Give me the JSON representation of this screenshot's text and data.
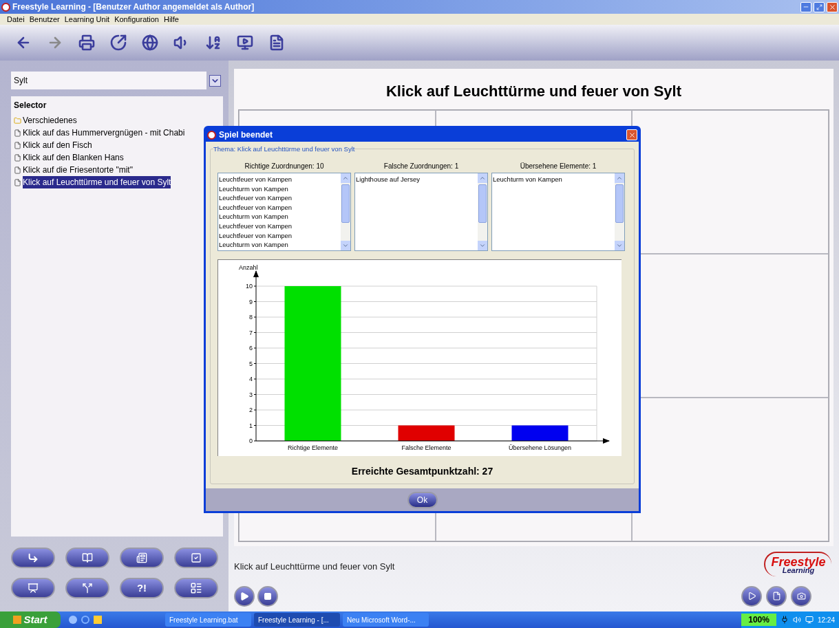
{
  "window": {
    "title": "Freestyle Learning - [Benutzer Author angemeldet als Author]"
  },
  "menu": [
    "Datei",
    "Benutzer",
    "Learning Unit",
    "Konfiguration",
    "Hilfe"
  ],
  "toolbar": [
    {
      "disabled": false
    },
    {
      "disabled": true
    },
    {
      "disabled": false
    },
    {
      "disabled": false
    },
    {
      "disabled": false
    },
    {
      "disabled": false
    },
    {
      "disabled": false
    },
    {
      "disabled": false
    },
    {
      "disabled": false
    }
  ],
  "unit_select": {
    "value": "Sylt"
  },
  "selector": {
    "title": "Selector",
    "items": [
      {
        "kind": "folder",
        "label": "Verschiedenes",
        "selected": false
      },
      {
        "kind": "document",
        "label": "Klick auf das Hummervergnügen - mit Chabi",
        "selected": false
      },
      {
        "kind": "document",
        "label": "Klick auf den Fisch",
        "selected": false
      },
      {
        "kind": "document",
        "label": "Klick auf den Blanken Hans",
        "selected": false
      },
      {
        "kind": "document",
        "label": "Klick auf die Friesentorte \"mit\"",
        "selected": false
      },
      {
        "kind": "document",
        "label": "Klick auf Leuchttürme und feuer von Sylt",
        "selected": true
      }
    ]
  },
  "quiz_button": {
    "label": "?!"
  },
  "content": {
    "title": "Klick auf Leuchttürme und feuer von Sylt",
    "caption": "Klick auf Leuchttürme und feuer von Sylt"
  },
  "logo": {
    "line1": "Freestyle",
    "line2": "Learning"
  },
  "dialog": {
    "title": "Spiel beendet",
    "group_title": "Thema: Klick auf Leuchttürme und feuer von Sylt",
    "lists": [
      {
        "header": "Richtige Zuordnungen: 10",
        "items": [
          "Leuchtfeuer von Kampen",
          "Leuchturm von Kampen",
          "Leuchtfeuer von Kampen",
          "Leuchtfeuer von Kampen",
          "Leuchturm von Kampen",
          "Leuchtfeuer von Kampen",
          "Leuchtfeuer von Kampen",
          "Leuchturm von Kampen"
        ]
      },
      {
        "header": "Falsche Zuordnungen: 1",
        "items": [
          "Lighthouse auf Jersey"
        ]
      },
      {
        "header": "Übersehene Elemente: 1",
        "items": [
          "Leuchturm von Kampen"
        ]
      }
    ],
    "chart_data": {
      "type": "bar",
      "ylabel": "Anzahl",
      "categories": [
        "Richtige Elemente",
        "Falsche Elemente",
        "Übersehene Lösungen"
      ],
      "series": [
        {
          "color": "#00e000",
          "values": [
            10,
            null,
            null
          ]
        },
        {
          "color": "#e00000",
          "values": [
            null,
            1,
            null
          ]
        },
        {
          "color": "#0000f0",
          "values": [
            null,
            null,
            1
          ]
        }
      ],
      "ylim": [
        0,
        10
      ],
      "yticks": [
        0,
        1,
        2,
        3,
        4,
        5,
        6,
        7,
        8,
        9,
        10
      ],
      "stacked": true,
      "grid": true
    },
    "score": "Erreichte Gesamtpunktzahl: 27",
    "ok_button": "Ok"
  },
  "taskbar": {
    "start": "Start",
    "tasks": [
      {
        "label": "Freestyle Learning.bat",
        "selected": false
      },
      {
        "label": "Freestyle Learning - [...",
        "selected": true
      },
      {
        "label": "Neu Microsoft Word-...",
        "selected": false
      }
    ],
    "battery": "100%",
    "clock": "12:24"
  }
}
